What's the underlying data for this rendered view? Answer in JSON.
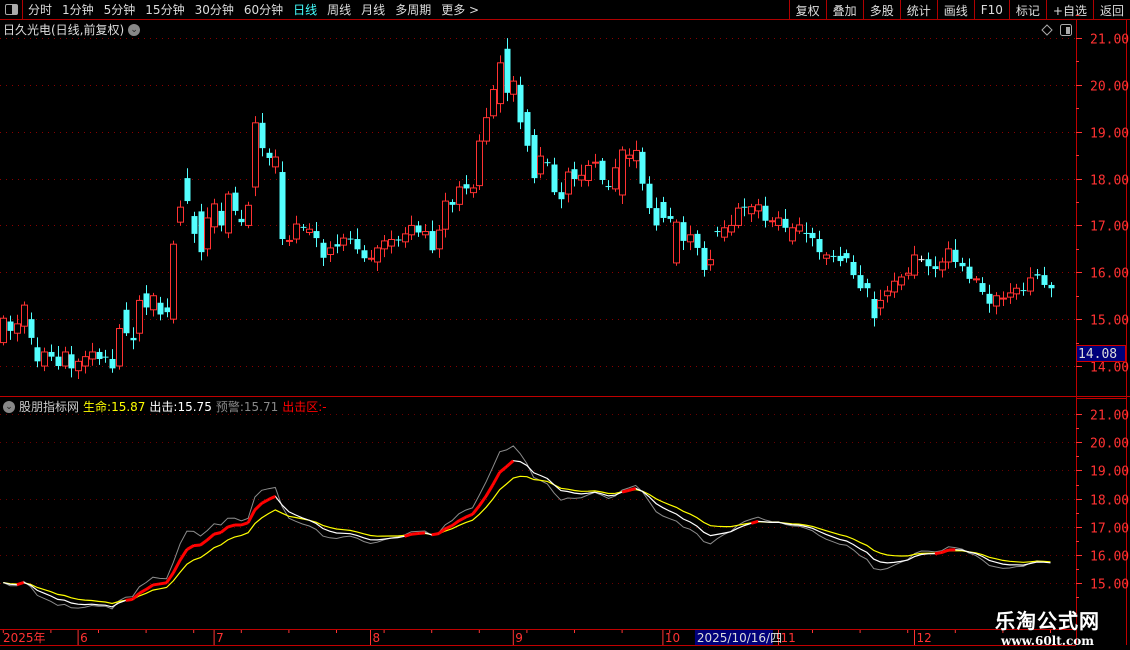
{
  "toolbar": {
    "items": [
      "分时",
      "1分钟",
      "5分钟",
      "15分钟",
      "30分钟",
      "60分钟",
      "日线",
      "周线",
      "月线",
      "多周期",
      "更多 >"
    ],
    "active": "日线",
    "buttons": [
      "复权",
      "叠加",
      "多股",
      "统计",
      "画线",
      "F10",
      "标记",
      "+自选",
      "返回"
    ]
  },
  "header": {
    "title": "日久光电(日线,前复权)",
    "dropdown_icon": "chevron-down-icon"
  },
  "indicator": {
    "name": "股朋指标网",
    "life_label": "生命:",
    "life_value": "15.87",
    "attack_label": "出击:",
    "attack_value": "15.75",
    "warn_label": "预警:",
    "warn_value": "15.71",
    "zone_label": "出击区:",
    "zone_value": "-"
  },
  "colors": {
    "up": "#ff3232",
    "down": "#54ffff",
    "axis": "#ff3232",
    "life": "#ffff00",
    "attack": "#ffffff",
    "warn": "#8c8c8c",
    "attack_zone": "#ff0000"
  },
  "price_box": "14.08",
  "date_axis": {
    "year": "2025年",
    "months": [
      {
        "label": "6",
        "index": 11
      },
      {
        "label": "7",
        "index": 31
      },
      {
        "label": "8",
        "index": 54
      },
      {
        "label": "9",
        "index": 75
      },
      {
        "label": "10",
        "index": 97
      },
      {
        "label": "11",
        "index": 114
      },
      {
        "label": "12",
        "index": 134
      }
    ],
    "cursor": {
      "label": "2025/10/16/四",
      "index": 102
    }
  },
  "watermark": {
    "line1": "乐淘公式网",
    "line2": "www.60lt.com"
  },
  "chart_data": [
    {
      "type": "candlestick",
      "title": "日久光电(日线,前复权)",
      "ylim": [
        13.7,
        21.3
      ],
      "yticks": [
        "21.00",
        "20.00",
        "19.00",
        "18.00",
        "17.00",
        "16.00",
        "15.00",
        "14.00"
      ],
      "grid": true,
      "ohlc_open_close": [
        [
          14.5,
          15.02
        ],
        [
          14.95,
          14.75
        ],
        [
          14.7,
          14.9
        ],
        [
          14.85,
          15.3
        ],
        [
          15.0,
          14.6
        ],
        [
          14.4,
          14.1
        ],
        [
          14.0,
          14.3
        ],
        [
          14.3,
          14.2
        ],
        [
          14.2,
          14.0
        ],
        [
          14.0,
          14.3
        ],
        [
          14.25,
          13.95
        ],
        [
          13.9,
          14.1
        ],
        [
          14.0,
          14.2
        ],
        [
          14.15,
          14.3
        ],
        [
          14.3,
          14.15
        ],
        [
          14.2,
          14.18
        ],
        [
          14.15,
          13.95
        ],
        [
          14.0,
          14.8
        ],
        [
          15.2,
          14.7
        ],
        [
          14.6,
          14.55
        ],
        [
          14.7,
          15.4
        ],
        [
          15.55,
          15.25
        ],
        [
          15.2,
          15.5
        ],
        [
          15.35,
          15.1
        ],
        [
          15.25,
          15.15
        ],
        [
          15.0,
          16.6
        ],
        [
          17.07,
          17.39
        ],
        [
          18.01,
          17.52
        ],
        [
          17.2,
          16.82
        ],
        [
          17.3,
          16.43
        ],
        [
          16.5,
          17.16
        ],
        [
          16.97,
          17.46
        ],
        [
          17.31,
          17.0
        ],
        [
          16.84,
          17.67
        ],
        [
          17.7,
          17.31
        ],
        [
          17.14,
          17.07
        ],
        [
          17.0,
          17.43
        ],
        [
          17.82,
          19.19
        ],
        [
          19.19,
          18.65
        ],
        [
          18.55,
          18.44
        ],
        [
          18.25,
          18.46
        ],
        [
          18.14,
          16.71
        ],
        [
          16.67,
          16.68
        ],
        [
          16.71,
          17.03
        ],
        [
          16.97,
          16.96
        ],
        [
          16.85,
          16.92
        ],
        [
          16.88,
          16.73
        ],
        [
          16.63,
          16.31
        ],
        [
          16.38,
          16.52
        ],
        [
          16.6,
          16.55
        ],
        [
          16.58,
          16.73
        ],
        [
          16.72,
          16.71
        ],
        [
          16.71,
          16.49
        ],
        [
          16.47,
          16.3
        ],
        [
          16.29,
          16.3
        ],
        [
          16.22,
          16.52
        ],
        [
          16.5,
          16.67
        ],
        [
          16.56,
          16.7
        ],
        [
          16.7,
          16.69
        ],
        [
          16.65,
          16.82
        ],
        [
          16.8,
          17.0
        ],
        [
          17.0,
          16.85
        ],
        [
          16.8,
          16.87
        ],
        [
          16.88,
          16.47
        ],
        [
          16.5,
          16.9
        ],
        [
          16.92,
          17.52
        ],
        [
          17.5,
          17.44
        ],
        [
          17.45,
          17.82
        ],
        [
          17.88,
          17.79
        ],
        [
          17.7,
          17.8
        ],
        [
          17.85,
          18.8
        ],
        [
          18.8,
          19.3
        ],
        [
          19.34,
          19.9
        ],
        [
          19.6,
          20.47
        ],
        [
          20.77,
          19.83
        ],
        [
          19.8,
          20.08
        ],
        [
          20.0,
          19.2
        ],
        [
          19.42,
          18.7
        ],
        [
          18.93,
          18.01
        ],
        [
          18.1,
          18.48
        ],
        [
          18.35,
          18.34
        ],
        [
          18.3,
          17.71
        ],
        [
          17.71,
          17.56
        ],
        [
          17.67,
          18.14
        ],
        [
          18.2,
          17.99
        ],
        [
          17.97,
          18.07
        ],
        [
          17.96,
          18.28
        ],
        [
          18.34,
          18.35
        ],
        [
          18.38,
          17.97
        ],
        [
          17.84,
          17.83
        ],
        [
          17.78,
          18.23
        ],
        [
          17.65,
          18.61
        ],
        [
          18.43,
          18.5
        ],
        [
          18.38,
          18.6
        ],
        [
          18.57,
          17.89
        ],
        [
          17.89,
          17.37
        ],
        [
          17.37,
          17.0
        ],
        [
          17.5,
          17.16
        ],
        [
          17.2,
          17.14
        ],
        [
          16.2,
          17.07
        ],
        [
          17.07,
          16.67
        ],
        [
          16.65,
          16.8
        ],
        [
          16.82,
          16.52
        ],
        [
          16.52,
          16.05
        ],
        [
          16.16,
          16.27
        ],
        [
          16.88,
          16.87
        ],
        [
          16.75,
          16.95
        ],
        [
          16.86,
          17.0
        ],
        [
          17.0,
          17.37
        ],
        [
          17.4,
          17.39
        ],
        [
          17.25,
          17.4
        ],
        [
          17.31,
          17.44
        ],
        [
          17.42,
          17.1
        ],
        [
          17.09,
          17.1
        ],
        [
          17.0,
          17.16
        ],
        [
          17.14,
          16.95
        ],
        [
          16.67,
          16.95
        ],
        [
          16.88,
          17.01
        ],
        [
          16.84,
          16.83
        ],
        [
          16.84,
          16.73
        ],
        [
          16.71,
          16.43
        ],
        [
          16.3,
          16.37
        ],
        [
          16.35,
          16.34
        ],
        [
          16.35,
          16.24
        ],
        [
          16.41,
          16.3
        ],
        [
          16.22,
          15.94
        ],
        [
          15.94,
          15.66
        ],
        [
          15.77,
          15.66
        ],
        [
          15.43,
          15.02
        ],
        [
          15.24,
          15.4
        ],
        [
          15.5,
          15.6
        ],
        [
          15.58,
          15.81
        ],
        [
          15.73,
          15.9
        ],
        [
          15.94,
          15.98
        ],
        [
          15.94,
          16.37
        ],
        [
          16.28,
          16.28
        ],
        [
          16.28,
          16.13
        ],
        [
          16.13,
          16.07
        ],
        [
          16.05,
          16.22
        ],
        [
          16.22,
          16.5
        ],
        [
          16.48,
          16.22
        ],
        [
          16.2,
          16.13
        ],
        [
          16.12,
          15.86
        ],
        [
          15.85,
          15.86
        ],
        [
          15.77,
          15.58
        ],
        [
          15.54,
          15.33
        ],
        [
          15.28,
          15.5
        ],
        [
          15.44,
          15.45
        ],
        [
          15.47,
          15.56
        ],
        [
          15.54,
          15.66
        ],
        [
          15.62,
          15.61
        ],
        [
          15.6,
          15.88
        ],
        [
          15.96,
          15.93
        ],
        [
          15.94,
          15.73
        ],
        [
          15.73,
          15.66
        ]
      ]
    },
    {
      "type": "line",
      "title": "股朋指标网",
      "ylim": [
        14.5,
        21.5
      ],
      "yticks": [
        "21.00",
        "20.00",
        "19.00",
        "18.00",
        "17.00",
        "16.00",
        "15.00"
      ],
      "series": [
        {
          "name": "生命",
          "smoothing": 14
        },
        {
          "name": "出击",
          "smoothing": 8
        },
        {
          "name": "预警",
          "smoothing": 4
        }
      ]
    }
  ]
}
